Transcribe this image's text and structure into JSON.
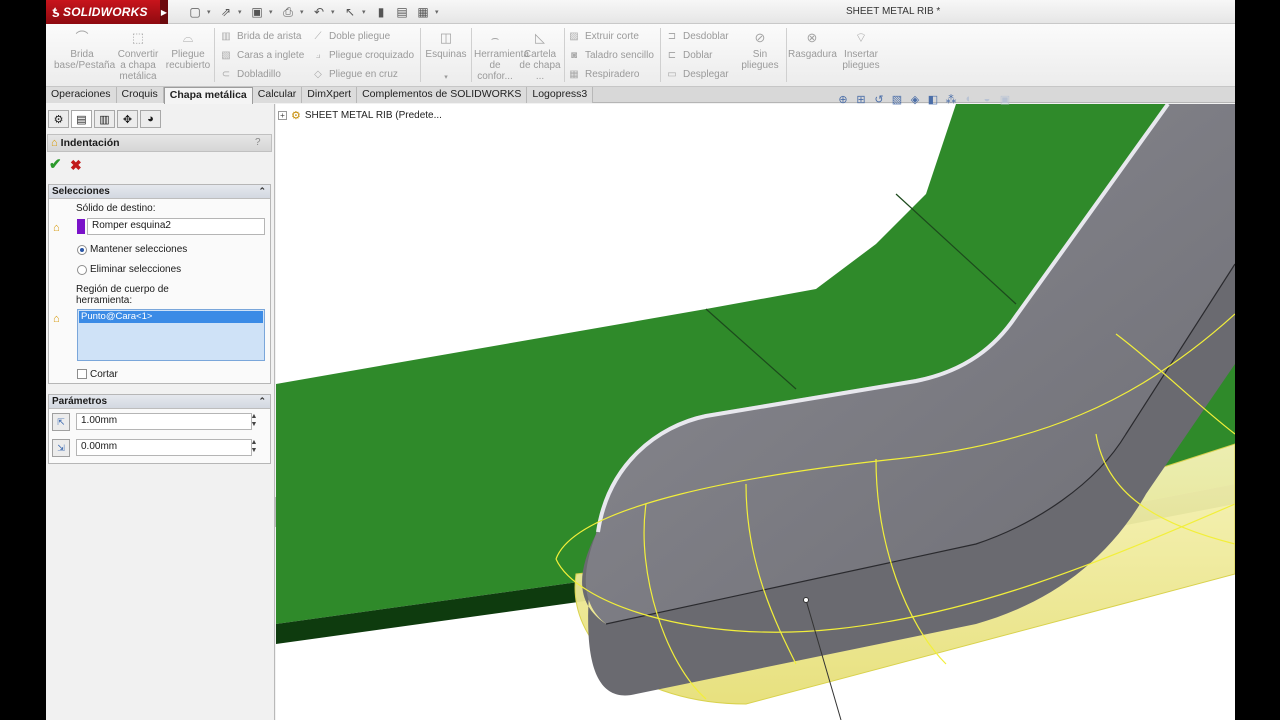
{
  "app": {
    "logo_text": "SOLIDWORKS",
    "document_title": "SHEET METAL RIB *"
  },
  "ribbon": {
    "brida_base": "Brida base/Pestaña",
    "convertir": "Convertir a chapa metálica",
    "pliegue_recubierto": "Pliegue recubierto",
    "brida_arista": "Brida de arista",
    "caras_ingleto": "Caras a inglete",
    "dobladillo": "Dobladillo",
    "doble_pliegue": "Doble pliegue",
    "pliegue_croquizado": "Pliegue croquizado",
    "pliegue_cruz": "Pliegue en cruz",
    "esquinas": "Esquinas",
    "herramienta_conformar": "Herramienta de confor...",
    "cartela_chapa": "Cartela de chapa ...",
    "extruir_corte": "Extruir corte",
    "taladro_sencillo": "Taladro sencillo",
    "respiradero": "Respiradero",
    "desdoblar": "Desdoblar",
    "doblar": "Doblar",
    "desplegar": "Desplegar",
    "sin_pliegues": "Sin pliegues",
    "rasgadura": "Rasgadura",
    "insertar_pliegues": "Insertar pliegues"
  },
  "tabs": [
    "Operaciones",
    "Croquis",
    "Chapa metálica",
    "Calcular",
    "DimXpert",
    "Complementos de SOLIDWORKS",
    "Logopress3"
  ],
  "active_tab": "Chapa metálica",
  "property_manager": {
    "title": "Indentación",
    "selections": {
      "header": "Selecciones",
      "target_label": "Sólido de destino:",
      "target_value": "Romper esquina2",
      "target_color": "#7a12c9",
      "keep_label": "Mantener selecciones",
      "remove_label": "Eliminar selecciones",
      "keep_selected": true,
      "region_label_1": "Región de cuerpo de",
      "region_label_2": "herramienta:",
      "region_item": "Punto@Cara<1>",
      "cut_label": "Cortar",
      "cut_checked": false
    },
    "parameters": {
      "header": "Parámetros",
      "thickness": "1.00mm",
      "clearance": "0.00mm"
    }
  },
  "viewport": {
    "tree_label": "SHEET METAL RIB  (Predete..."
  },
  "colors": {
    "accent_green": "#1f8a1f",
    "part_gray": "#7d7d84",
    "selection_yellow": "#f2ef3a"
  }
}
